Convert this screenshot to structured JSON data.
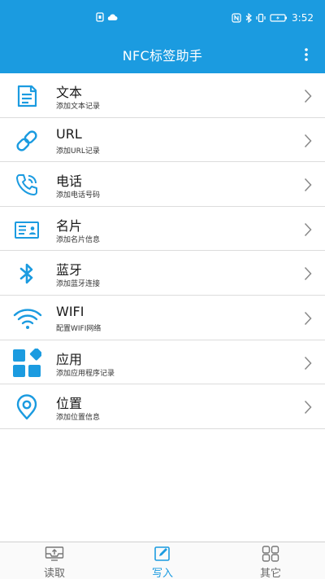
{
  "status_bar": {
    "time": "3:52",
    "icons": [
      "notification-icon",
      "cloud-icon",
      "nfc-icon",
      "bluetooth-icon",
      "vibrate-icon",
      "battery-icon"
    ]
  },
  "app_bar": {
    "title": "NFC标签助手",
    "menu_icon": "more-vertical-icon"
  },
  "items": [
    {
      "title": "文本",
      "subtitle": "添加文本记录",
      "icon": "document-icon"
    },
    {
      "title": "URL",
      "subtitle": "添加URL记录",
      "icon": "link-icon"
    },
    {
      "title": "电话",
      "subtitle": "添加电话号码",
      "icon": "phone-icon"
    },
    {
      "title": "名片",
      "subtitle": "添加名片信息",
      "icon": "business-card-icon"
    },
    {
      "title": "蓝牙",
      "subtitle": "添加蓝牙连接",
      "icon": "bluetooth-icon"
    },
    {
      "title": "WIFI",
      "subtitle": "配置WIFI网络",
      "icon": "wifi-icon"
    },
    {
      "title": "应用",
      "subtitle": "添加应用程序记录",
      "icon": "apps-icon"
    },
    {
      "title": "位置",
      "subtitle": "添加位置信息",
      "icon": "location-icon"
    }
  ],
  "tabs": [
    {
      "label": "读取",
      "icon": "read-tray-icon",
      "active": false
    },
    {
      "label": "写入",
      "icon": "write-edit-icon",
      "active": true
    },
    {
      "label": "其它",
      "icon": "grid-other-icon",
      "active": false
    }
  ],
  "colors": {
    "accent": "#1b9be0",
    "divider": "#dcdcdc"
  }
}
